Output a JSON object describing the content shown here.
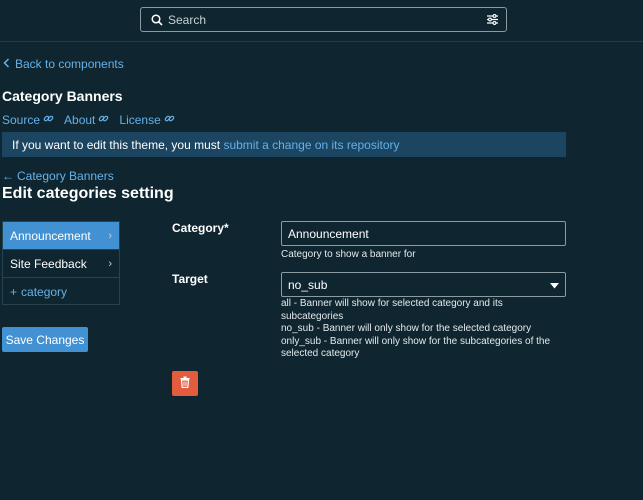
{
  "search": {
    "placeholder": "Search"
  },
  "nav": {
    "back_label": "Back to components"
  },
  "component": {
    "title": "Category Banners",
    "links": [
      "Source",
      "About",
      "License"
    ]
  },
  "notice": {
    "text": "If you want to edit this theme, you must ",
    "link": "submit a change on its repository"
  },
  "breadcrumb": {
    "label": "Category Banners"
  },
  "settings": {
    "title": "Edit categories setting",
    "categories": [
      "Announcement",
      "Site Feedback"
    ],
    "add_label": "category"
  },
  "form": {
    "category_label": "Category*",
    "category_value": "Announcement",
    "category_help": "Category to show a banner for",
    "target_label": "Target",
    "target_value": "no_sub",
    "target_help": [
      "all - Banner will show for selected category and its",
      "subcategories",
      "no_sub - Banner will only show for the selected category",
      "only_sub - Banner will only show for the subcategories of the",
      "selected category"
    ]
  },
  "actions": {
    "save_label": "Save Changes"
  },
  "colors": {
    "background": "#0f2630",
    "accent": "#4191d3",
    "link": "#65b1e9",
    "danger": "#e45c3e",
    "notice": "#1b4560"
  }
}
